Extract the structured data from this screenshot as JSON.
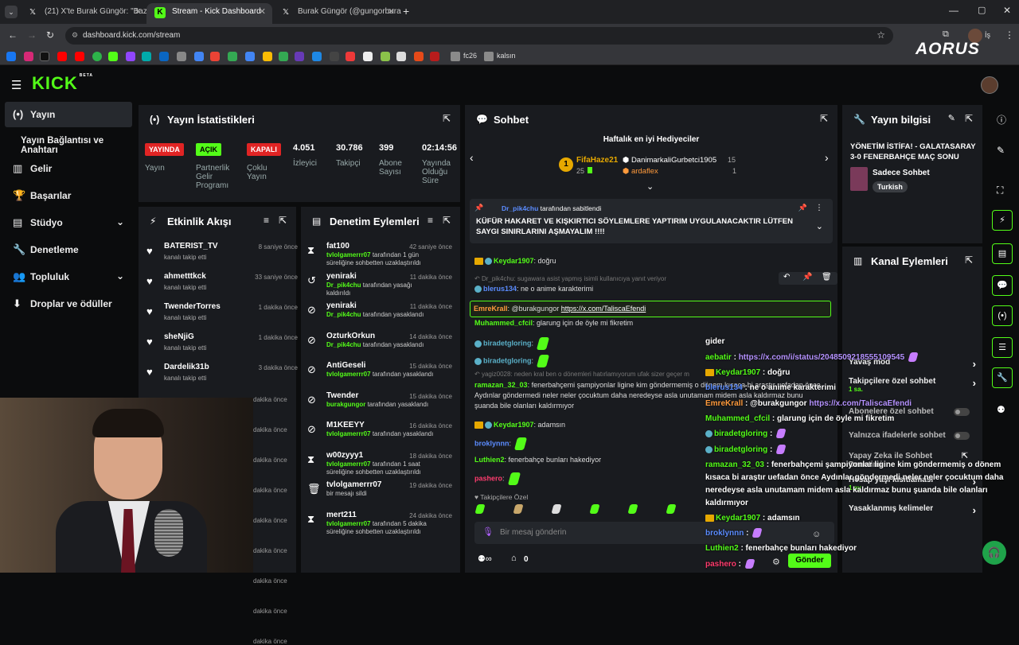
{
  "browser": {
    "tabs": [
      {
        "label": "(21) X'te Burak Güngör: \"Bazı şe",
        "icon": "X",
        "color": "#fff"
      },
      {
        "label": "Stream - Kick Dashboard",
        "icon": "K",
        "color": "#53fc18"
      },
      {
        "label": "Burak Güngör (@gungorburak)",
        "icon": "X",
        "color": "#fff"
      }
    ],
    "url": "dashboard.kick.com/stream",
    "bookmarks": [
      "fc26",
      "kalsın"
    ],
    "brand": "AORUS",
    "profile_badge": "İş"
  },
  "header": {
    "logo": "KICK",
    "beta": "BETA"
  },
  "sidebar": {
    "items": [
      {
        "label": "Yayın",
        "icon": "broadcast-icon"
      },
      {
        "label": "Yayın Bağlantısı ve Anahtarı",
        "icon": ""
      },
      {
        "label": "Gelir",
        "icon": "chart-icon"
      },
      {
        "label": "Başarılar",
        "icon": "trophy-icon"
      },
      {
        "label": "Stüdyo",
        "icon": "studio-icon"
      },
      {
        "label": "Denetleme",
        "icon": "wrench-icon"
      },
      {
        "label": "Topluluk",
        "icon": "community-icon"
      },
      {
        "label": "Droplar ve ödüller",
        "icon": "drops-icon"
      }
    ]
  },
  "stats": {
    "title": "Yayın İstatistikleri",
    "items": [
      {
        "badge": "YAYINDA",
        "label": "Yayın",
        "color": "#e02424"
      },
      {
        "badge": "AÇIK",
        "label": "Partnerlik Gelir Programı",
        "color": "#53fc18"
      },
      {
        "badge": "KAPALI",
        "label": "Çoklu Yayın",
        "color": "#e02424"
      },
      {
        "value": "4.051",
        "label": "İzleyici"
      },
      {
        "value": "30.786",
        "label": "Takipçi"
      },
      {
        "value": "399",
        "label": "Abone Sayısı"
      },
      {
        "value": "02:14:56",
        "label": "Yayında Olduğu Süre"
      }
    ]
  },
  "activity": {
    "title": "Etkinlik Akışı",
    "events": [
      {
        "name": "BATERIST_TV",
        "sub": "kanalı takip etti",
        "time": "8 saniye önce"
      },
      {
        "name": "ahmetttkck",
        "sub": "kanalı takip etti",
        "time": "33 saniye önce"
      },
      {
        "name": "TwenderTorres",
        "sub": "kanalı takip etti",
        "time": "1 dakika önce"
      },
      {
        "name": "sheNjiG",
        "sub": "kanalı takip etti",
        "time": "1 dakika önce"
      },
      {
        "name": "Dardelik31b",
        "sub": "kanalı takip etti",
        "time": "3 dakika önce"
      }
    ],
    "hidden_times": [
      "dakika önce",
      "dakika önce",
      "dakika önce",
      "dakika önce",
      "dakika önce",
      "dakika önce",
      "dakika önce",
      "dakika önce",
      "dakika önce"
    ]
  },
  "moderation": {
    "title": "Denetim Eylemleri",
    "items": [
      {
        "icon": "⧗",
        "name": "fat100",
        "actor": "tvlolgamerrr07",
        "sub": " tarafından 1 gün süreliğine sohbetten uzaklaştırıldı",
        "time": "42 saniye önce"
      },
      {
        "icon": "↺",
        "name": "yeniraki",
        "actor": "Dr_pik4chu",
        "sub": " tarafından yasağı kaldırıldı",
        "time": "11 dakika önce"
      },
      {
        "icon": "⊘",
        "name": "yeniraki",
        "actor": "Dr_pik4chu",
        "sub": " tarafından yasaklandı",
        "time": "11 dakika önce"
      },
      {
        "icon": "⊘",
        "name": "OzturkOrkun",
        "actor": "Dr_pik4chu",
        "sub": " tarafından yasaklandı",
        "time": "14 dakika önce"
      },
      {
        "icon": "⊘",
        "name": "AntiGeseli",
        "actor": "tvlolgamerrr07",
        "sub": " tarafından yasaklandı",
        "time": "15 dakika önce"
      },
      {
        "icon": "⊘",
        "name": "Twender",
        "actor": "burakgungor",
        "sub": " tarafından yasaklandı",
        "time": "15 dakika önce"
      },
      {
        "icon": "⊘",
        "name": "M1KEEYY",
        "actor": "tvlolgamerrr07",
        "sub": " tarafından yasaklandı",
        "time": "16 dakika önce"
      },
      {
        "icon": "⧗",
        "name": "w00zyyy1",
        "actor": "tvlolgamerrr07",
        "sub": " tarafından 1 saat süreliğine sohbetten uzaklaştırıldı",
        "time": "18 dakika önce"
      },
      {
        "icon": "🗑",
        "name": "tvlolgamerrr07",
        "actor": "",
        "sub": "bir mesajı sildi",
        "time": "19 dakika önce"
      },
      {
        "icon": "⧗",
        "name": "mert211",
        "actor": "tvlolgamerrr07",
        "sub": " tarafından 5 dakika süreliğine sohbetten uzaklaştırıldı",
        "time": "24 dakika önce"
      }
    ]
  },
  "chat": {
    "title": "Sohbet",
    "gifters_title": "Haftalık en iyi Hediyeciler",
    "gifters": [
      {
        "rank": "1",
        "name": "FifaHaze21",
        "count": "25"
      },
      {
        "name": "DanimarkaliGurbetci1905",
        "count": "15"
      },
      {
        "name": "ardaflex",
        "count": "1"
      }
    ],
    "pinned": {
      "by": "Dr_pik4chu",
      "by_suffix": " tarafından sabitlendi",
      "text": "KÜFÜR HAKARET VE KIŞKIRTICI SÖYLEMLERE YAPTIRIM UYGULANACAKTIR LÜTFEN SAYGI SINIRLARINI AŞMAYALIM !!!!"
    },
    "messages": [
      {
        "user": "Keydar1907",
        "color": "#53fc18",
        "text": ": doğru"
      },
      {
        "reply": "Dr_pik4chu: sugawara asist yapmış isimli kullanıcıya yanıt veriyor"
      },
      {
        "user": "blerus134",
        "color": "#5b8cff",
        "text": ": ne o anime karakterimi"
      },
      {
        "user": "EmreKrall",
        "color": "#ff9a3c",
        "text": ": @burakgungor ",
        "link": "https://x.com/TaliscaEfendi"
      },
      {
        "user": "Muhammed_cfcil",
        "color": "#53fc18",
        "text": ": glarung için de öyle mi fikretim"
      },
      {
        "user": "biradetgloring",
        "color": "#5ab0c8",
        "text": ":"
      },
      {
        "user": "biradetgloring",
        "color": "#5ab0c8",
        "text": ":"
      },
      {
        "reply": "yagiz0028: neden kral ben o dönemleri hatırlamıyorum ufak sizer geçer m"
      },
      {
        "user": "ramazan_32_03",
        "color": "#53fc18",
        "text": ": fenerbahçemi şampiyonlar ligine kim göndermemiş o dönem kısaca bi araştır uefadan önce Aydınlar göndermedi neler neler çocuktum daha neredeyse asla unutamam midem asla kaldırmaz bunu şuanda bile olanları kaldırmıyor"
      },
      {
        "user": "Keydar1907",
        "color": "#53fc18",
        "text": ": adamsın"
      },
      {
        "user": "broklynnn",
        "color": "#5b8cff",
        "text": ":"
      },
      {
        "user": "Luthien2",
        "color": "#53fc18",
        "text": ": fenerbahçe bunları hakediyor"
      },
      {
        "user": "pashero",
        "color": "#ff3c6e",
        "text": ":"
      }
    ],
    "followers_only": "Takipçilere Özel",
    "input_placeholder": "Bir mesaj gönderin",
    "count": "0",
    "send": "Gönder"
  },
  "overlay": {
    "lines": [
      {
        "user": "",
        "text": "gider"
      },
      {
        "user": "aebatir",
        "color": "#53fc18",
        "text": " : ",
        "link": "https://x.com/i/status/2048509218555109545"
      },
      {
        "user": "Keydar1907",
        "color": "#53fc18",
        "text": " : doğru"
      },
      {
        "user": "blerus134",
        "color": "#5b8cff",
        "text": " : ne o anime karakterimi"
      },
      {
        "user": "EmreKrall",
        "color": "#ff9a3c",
        "text": " : @burakgungor ",
        "link": "https://x.com/TaliscaEfendi"
      },
      {
        "user": "Muhammed_cfcil",
        "color": "#53fc18",
        "text": " : glarung için de öyle mi fikretim"
      },
      {
        "user": "biradetgloring",
        "color": "#53fc18",
        "text": " :"
      },
      {
        "user": "biradetgloring",
        "color": "#53fc18",
        "text": " :"
      },
      {
        "user": "ramazan_32_03",
        "color": "#53fc18",
        "text": " : fenerbahçemi şampiyonlar ligine kim göndermemiş o dönem kısaca bi araştır uefadan önce Aydınlar göndermedi neler neler çocuktum daha neredeyse asla unutamam midem asla kaldırmaz bunu şuanda bile olanları kaldırmıyor"
      },
      {
        "user": "Keydar1907",
        "color": "#53fc18",
        "text": " : adamsın"
      },
      {
        "user": "broklynnn",
        "color": "#5b8cff",
        "text": " :"
      },
      {
        "user": "Luthien2",
        "color": "#53fc18",
        "text": " : fenerbahçe bunları hakediyor"
      },
      {
        "user": "pashero",
        "color": "#ff3c6e",
        "text": " :"
      }
    ]
  },
  "stream_info": {
    "title": "Yayın bilgisi",
    "stream_title": "YÖNETİM İSTİFA! - GALATASARAY 3-0 FENERBAHÇE MAÇ SONU",
    "category": "Sadece Sohbet",
    "language": "Turkish"
  },
  "channel_actions": {
    "title": "Kanal Eylemleri",
    "items": [
      {
        "label": "Yavaş mod",
        "sub": "",
        "type": "arrow"
      },
      {
        "label": "Takipçilere özel sohbet",
        "sub": "1 sa.",
        "type": "arrow"
      },
      {
        "label": "Abonelere özel sohbet",
        "sub": "",
        "type": "toggle"
      },
      {
        "label": "Yalnızca ifadelerle sohbet",
        "sub": "",
        "type": "toggle"
      },
      {
        "label": "Yapay Zeka ile Sohbet Denetimi",
        "sub": "",
        "type": "pop"
      },
      {
        "label": "Hesap yaşı kısıtlaması",
        "sub": "1 ay",
        "type": "arrow"
      },
      {
        "label": "Yasaklanmış kelimeler",
        "sub": "",
        "type": "arrow"
      }
    ]
  }
}
